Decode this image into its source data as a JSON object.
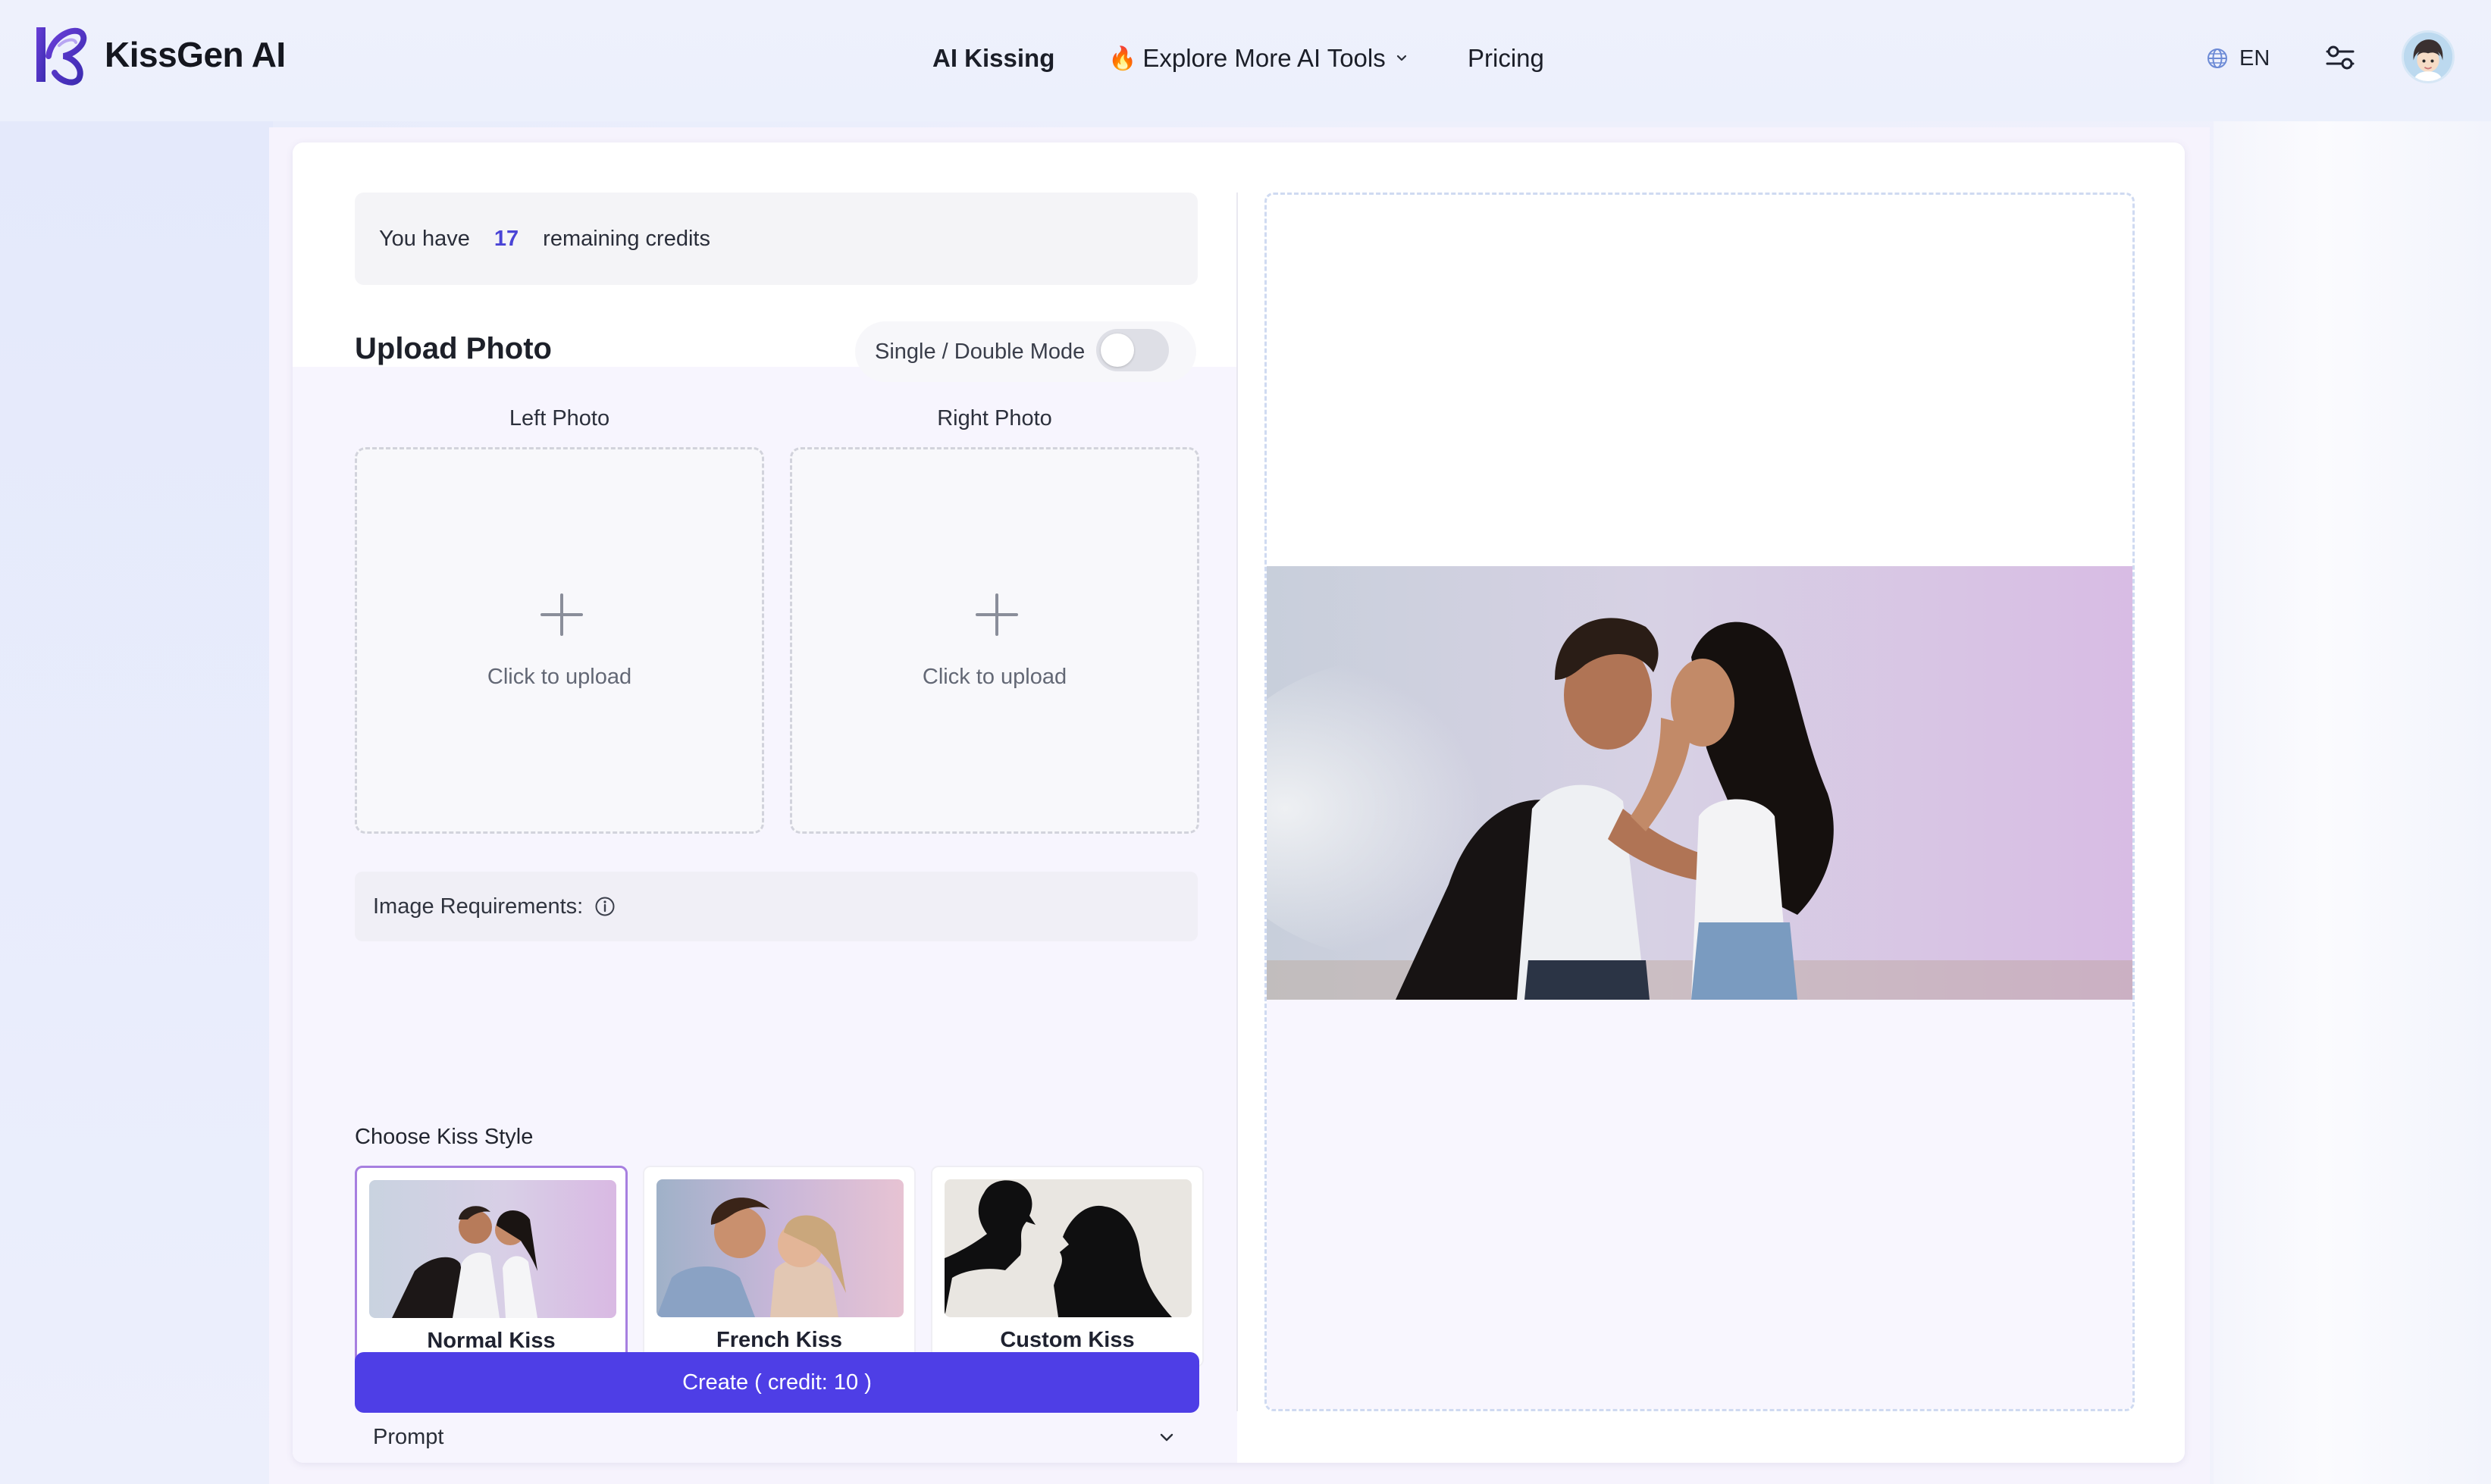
{
  "brand": {
    "name": "KissGen AI"
  },
  "nav": {
    "items": [
      {
        "label": "AI Kissing"
      },
      {
        "label": "Explore More AI Tools",
        "icon": "fire-icon",
        "has_dropdown": true
      },
      {
        "label": "Pricing"
      }
    ]
  },
  "header": {
    "language": "EN",
    "language_icon": "globe-icon",
    "settings_icon": "sliders-icon"
  },
  "credits": {
    "prefix": "You have",
    "count": "17",
    "suffix": "remaining credits"
  },
  "upload": {
    "title": "Upload Photo",
    "mode_label": "Single / Double Mode",
    "mode_enabled": false,
    "left_label": "Left Photo",
    "right_label": "Right Photo",
    "placeholder": "Click to upload"
  },
  "requirements": {
    "label": "Image Requirements:",
    "icon": "info-icon"
  },
  "styles": {
    "title": "Choose Kiss Style",
    "options": [
      {
        "label": "Normal Kiss",
        "selected": true
      },
      {
        "label": "French Kiss",
        "selected": false
      },
      {
        "label": "Custom Kiss",
        "selected": false
      }
    ]
  },
  "prompt": {
    "label": "Prompt"
  },
  "create": {
    "label": "Create ( credit: 10 )"
  },
  "colors": {
    "accent": "#4e3ee6",
    "credit_number": "#4a44d6",
    "selected_border": "#a77fe0"
  }
}
